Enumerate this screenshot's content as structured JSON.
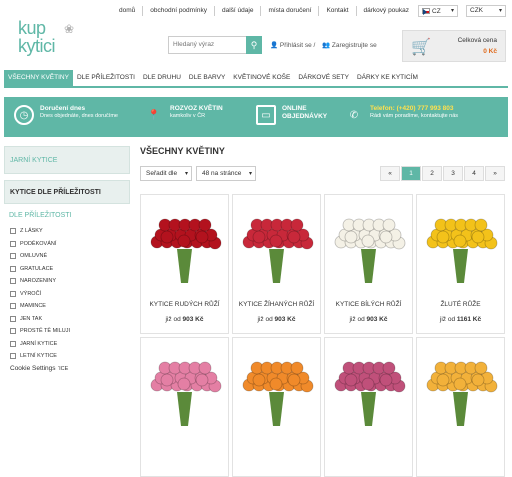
{
  "logo": {
    "line1": "kup",
    "line2": "kytici"
  },
  "topnav": [
    "domů",
    "obchodní podmínky",
    "další údaje",
    "místa doručení",
    "Kontakt",
    "dárkový poukaz"
  ],
  "language": "CZ",
  "currency": "CZK",
  "search": {
    "placeholder": "Hledaný výraz"
  },
  "account": {
    "login": "Přihlásit se /",
    "register": "Zaregistrujte se"
  },
  "cart": {
    "label": "Celková cena",
    "price": "0 Kč"
  },
  "categories": [
    "VŠECHNY KVĚTINY",
    "DLE PŘÍLEŽITOSTI",
    "DLE DRUHU",
    "DLE BARVY",
    "KVĚTINOVÉ KOŠE",
    "DÁRKOVÉ SETY",
    "DÁRKY KE KYTICÍM"
  ],
  "banner": [
    {
      "title": "Doručení dnes",
      "sub": "Dnes objednáte, dnes doručíme"
    },
    {
      "title": "ROZVOZ KVĚTIN",
      "sub": "kamkoliv v ČR"
    },
    {
      "title": "ONLINE",
      "sub": "OBJEDNÁVKY"
    },
    {
      "title": "Telefon: (+420) 777 993 803",
      "sub": "Rádi vám poradíme, kontaktujte nás"
    }
  ],
  "sidebar": {
    "h1": "JARNÍ KYTICE",
    "h2": "KYTICE DLE PŘÍLEŽITOSTI",
    "sub": "DLE PŘÍLEŽITOSTI",
    "items": [
      "Z LÁSKY",
      "PODĚKOVÁNÍ",
      "OMLUVNÉ",
      "GRATULACE",
      "NAROZENINY",
      "VÝROČÍ",
      "MAMINCE",
      "JEN TAK",
      "PROSTĚ TĚ MILUJI",
      "JARNÍ KYTICE",
      "LETNÍ KYTICE",
      "PODZIMNÍ KYTICE"
    ]
  },
  "main": {
    "title": "VŠECHNY KVĚTINY",
    "sort": "Seřadit dle",
    "perpage": "48 na stránce",
    "pages": [
      "«",
      "1",
      "2",
      "3",
      "4",
      "»"
    ]
  },
  "products": [
    {
      "name": "KYTICE RUDÝCH RŮŽÍ",
      "from": "již od",
      "price": "903 Kč",
      "color": "#b3121e"
    },
    {
      "name": "KYTICE ŽÍHANÝCH RŮŽÍ",
      "from": "již od",
      "price": "903 Kč",
      "color": "#c8283a"
    },
    {
      "name": "KYTICE BÍLÝCH RŮŽÍ",
      "from": "již od",
      "price": "903 Kč",
      "color": "#f4f1e6"
    },
    {
      "name": "ŽLUTÉ RŮŽE",
      "from": "již od",
      "price": "1161 Kč",
      "color": "#f3c21a"
    },
    {
      "name": "",
      "from": "",
      "price": "",
      "color": "#e47fa4"
    },
    {
      "name": "",
      "from": "",
      "price": "",
      "color": "#f08a2a"
    },
    {
      "name": "",
      "from": "",
      "price": "",
      "color": "#c0507a"
    },
    {
      "name": "",
      "from": "",
      "price": "",
      "color": "#f2b13a"
    }
  ],
  "cookie": "Cookie Settings"
}
